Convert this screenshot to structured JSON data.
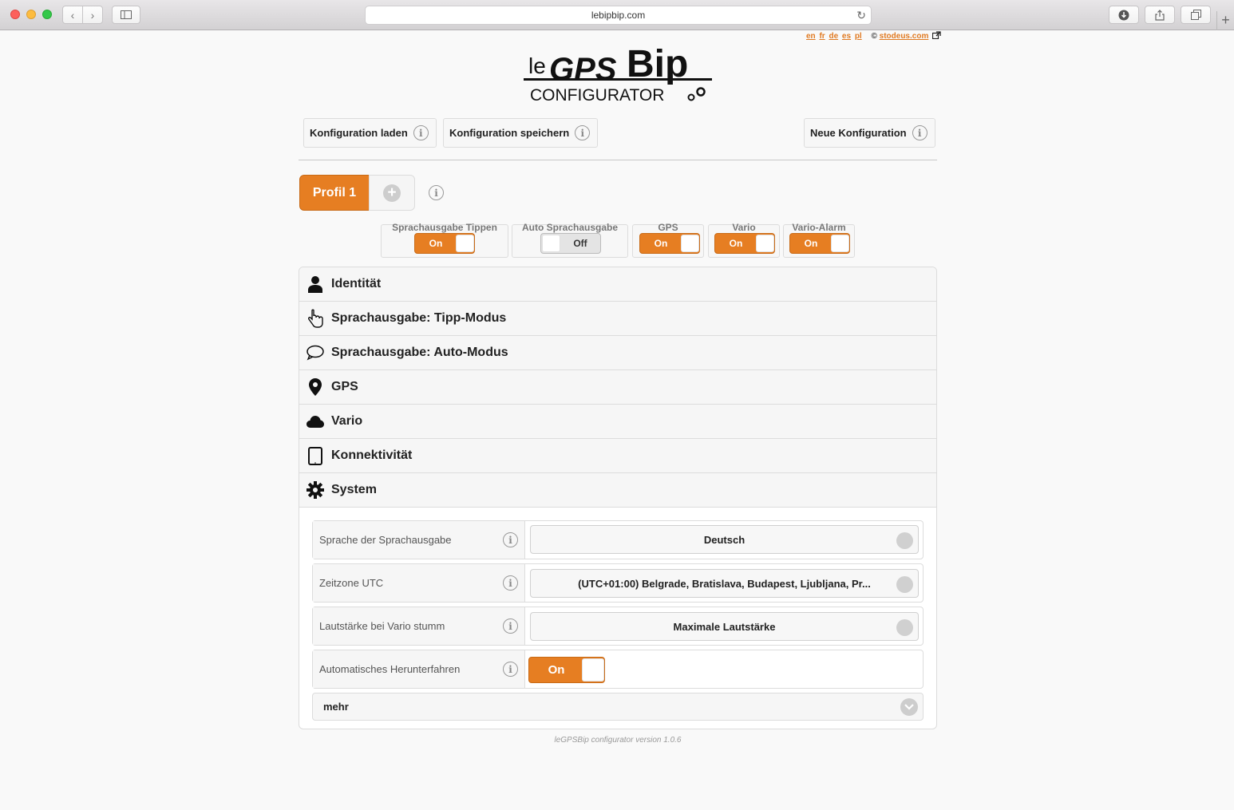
{
  "browser": {
    "url": "lebipbip.com"
  },
  "header": {
    "langs": [
      "en",
      "fr",
      "de",
      "es",
      "pl"
    ],
    "copyright_symbol": "©",
    "copyright_link": "stodeus.com",
    "logo_le": "le",
    "logo_gps": "GPS",
    "logo_bip": "Bip",
    "logo_sub": "CONFIGURATOR"
  },
  "toolbar": {
    "load_label": "Konfiguration laden",
    "save_label": "Konfiguration speichern",
    "new_label": "Neue Konfiguration"
  },
  "profiles": {
    "tabs": [
      {
        "label": "Profil 1"
      }
    ]
  },
  "toggles": [
    {
      "label": "Sprachausgabe Tippen",
      "state": "On"
    },
    {
      "label": "Auto Sprachausgabe",
      "state": "Off"
    },
    {
      "label": "GPS",
      "state": "On"
    },
    {
      "label": "Vario",
      "state": "On"
    },
    {
      "label": "Vario-Alarm",
      "state": "On"
    }
  ],
  "sections": [
    {
      "label": "Identität",
      "icon": "person-icon"
    },
    {
      "label": "Sprachausgabe: Tipp-Modus",
      "icon": "pointing-hand-icon"
    },
    {
      "label": "Sprachausgabe: Auto-Modus",
      "icon": "speech-bubble-icon"
    },
    {
      "label": "GPS",
      "icon": "map-marker-icon"
    },
    {
      "label": "Vario",
      "icon": "cloud-icon"
    },
    {
      "label": "Konnektivität",
      "icon": "tablet-icon"
    },
    {
      "label": "System",
      "icon": "gear-icon"
    }
  ],
  "system": {
    "settings": [
      {
        "label": "Sprache der Sprachausgabe",
        "value": "Deutsch"
      },
      {
        "label": "Zeitzone UTC",
        "value": "(UTC+01:00) Belgrade, Bratislava, Budapest, Ljubljana, Pr..."
      },
      {
        "label": "Lautstärke bei Vario stumm",
        "value": "Maximale Lautstärke"
      },
      {
        "label": "Automatisches Herunterfahren",
        "value": "On"
      }
    ],
    "more_label": "mehr"
  },
  "colors": {
    "accent": "#e67e22",
    "accent_border": "#c86a16"
  },
  "footer": {
    "version_text": "leGPSBip configurator version 1.0.6"
  }
}
